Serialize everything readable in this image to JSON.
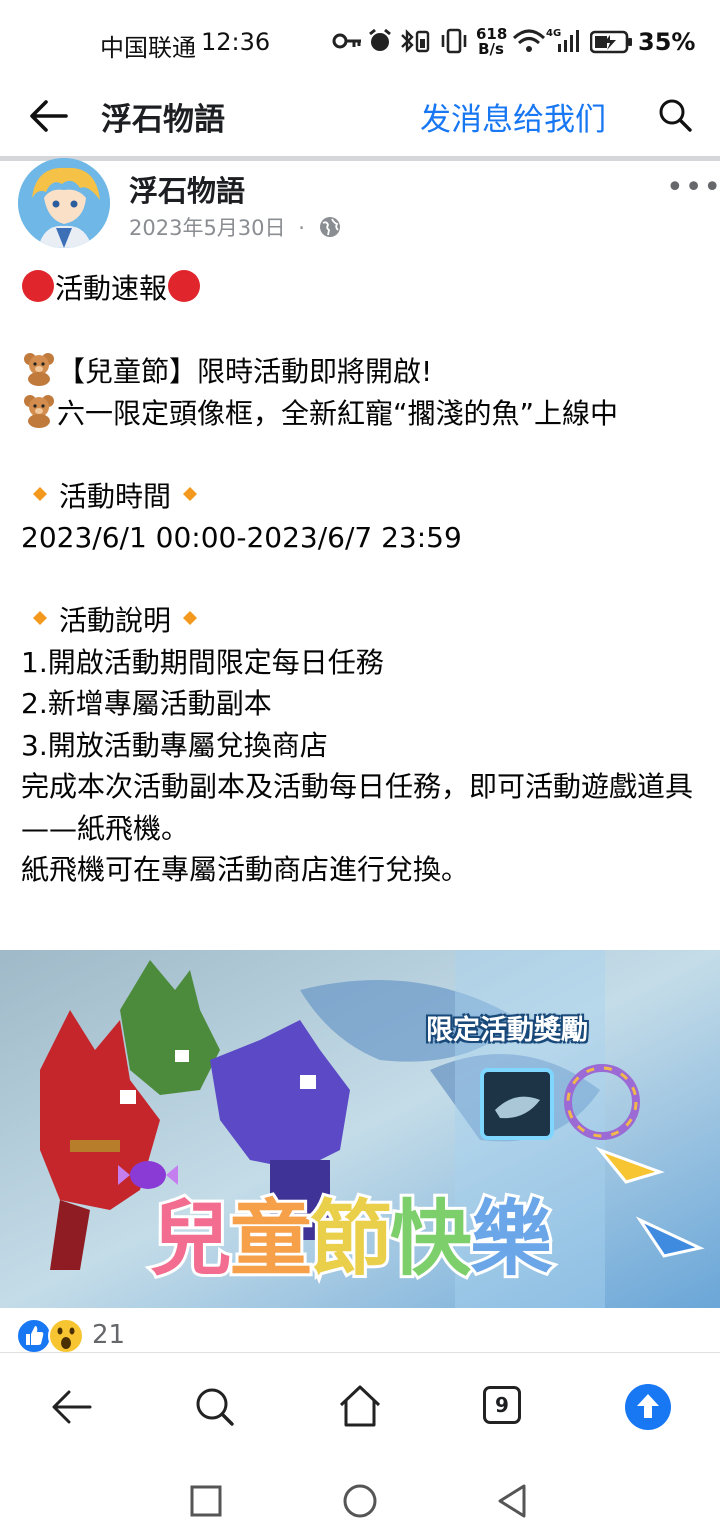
{
  "status_bar": {
    "carrier": "中国联通",
    "time": "12:36",
    "speed_value": "618",
    "speed_unit": "B/s",
    "network": "4G",
    "battery": "35%"
  },
  "header": {
    "title": "浮石物語",
    "message_button": "发消息给我们"
  },
  "post": {
    "page_name": "浮石物語",
    "date": "2023年5月30日",
    "date_separator": "·",
    "lines": [
      "活動速報",
      "【兒童節】限時活動即將開啟!",
      "六一限定頭像框，全新紅寵“擱淺的魚”上線中",
      "活動時間",
      "2023/6/1 00:00-2023/6/7 23:59",
      "活動說明",
      "1.開啟活動期間限定每日任務",
      "2.新增專屬活動副本",
      "3.開放活動專屬兌換商店",
      "完成本次活動副本及活動每日任務，即可活動遊戲道具——紙飛機。",
      "紙飛機可在專屬活動商店進行兌換。"
    ]
  },
  "banner": {
    "reward_label": "限定活動獎勵",
    "title_chars": [
      "兒",
      "童",
      "節",
      "快",
      "樂"
    ],
    "title_colors": [
      "#f26d8f",
      "#f7a04a",
      "#e9cf4a",
      "#7ccf6a",
      "#6aa6e8"
    ]
  },
  "reactions": {
    "count": "21",
    "types": [
      "like-icon",
      "wow-icon"
    ]
  },
  "browser_nav": {
    "tab_count": "9"
  },
  "colors": {
    "accent": "#1877f2",
    "text": "#050505",
    "muted": "#8a8d91"
  }
}
